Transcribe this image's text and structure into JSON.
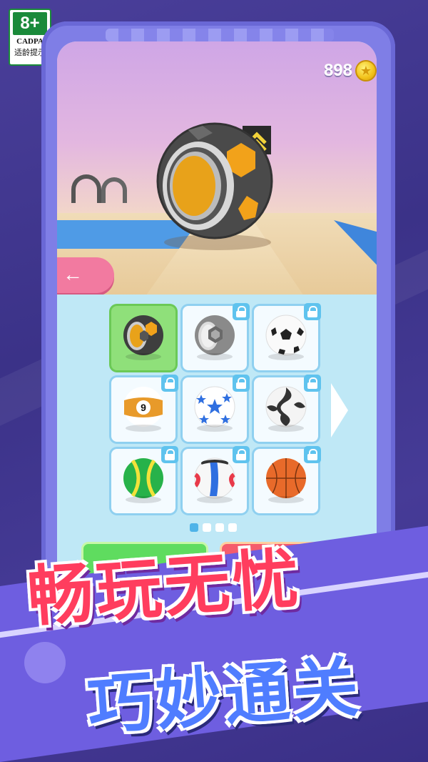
{
  "age_rating": {
    "badge": "8+",
    "org": "CADPA",
    "tip": "适龄提示"
  },
  "hud": {
    "coins": "898",
    "coin_icon": "star-coin-icon"
  },
  "scene": {
    "back_arrow": "←",
    "featured_ball": "hexagon-gold-gray-ball"
  },
  "ball_grid": {
    "items": [
      {
        "name": "hex-gold-ball",
        "selected": true,
        "locked": false
      },
      {
        "name": "hex-silver-ball",
        "selected": false,
        "locked": true
      },
      {
        "name": "classic-soccer-ball",
        "selected": false,
        "locked": true
      },
      {
        "name": "nine-billiard-ball",
        "label": "9",
        "selected": false,
        "locked": true
      },
      {
        "name": "blue-star-soccer-ball",
        "selected": false,
        "locked": true
      },
      {
        "name": "black-white-swirl-ball",
        "selected": false,
        "locked": true
      },
      {
        "name": "tennis-ball",
        "selected": false,
        "locked": true
      },
      {
        "name": "volleyball",
        "selected": false,
        "locked": true
      },
      {
        "name": "basketball",
        "selected": false,
        "locked": true
      }
    ],
    "page_dots": 4,
    "active_page": 0
  },
  "actions": {
    "unlock_cost_icon": "star-coin-icon",
    "video_icon": "play-icon"
  },
  "slogans": {
    "line1": "畅玩无忧",
    "line2": "巧妙通关"
  },
  "colors": {
    "accent_pink": "#f27aa0",
    "selected_green": "#8fe07a",
    "lock_blue": "#5fc3ee",
    "slogan_red": "#ff3d5e",
    "slogan_blue": "#4f7dff"
  }
}
